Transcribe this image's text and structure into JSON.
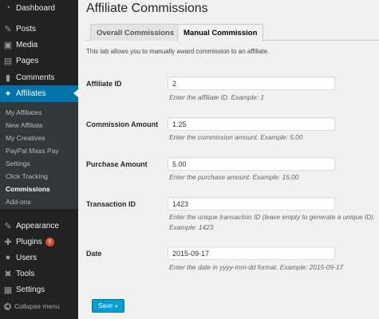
{
  "sidebar": {
    "menu": [
      {
        "id": "dashboard",
        "label": "Dashboard",
        "icon": "dashboard-icon",
        "glyph": "◔"
      },
      {
        "id": "posts",
        "label": "Posts",
        "icon": "pin-icon",
        "glyph": "✎"
      },
      {
        "id": "media",
        "label": "Media",
        "icon": "media-icon",
        "glyph": "▣"
      },
      {
        "id": "pages",
        "label": "Pages",
        "icon": "pages-icon",
        "glyph": "▤"
      },
      {
        "id": "comments",
        "label": "Comments",
        "icon": "comments-icon",
        "glyph": "▮"
      },
      {
        "id": "affiliates",
        "label": "Affiliates",
        "icon": "affiliates-icon",
        "glyph": "✦"
      }
    ],
    "submenu": [
      {
        "label": "My Affiliates"
      },
      {
        "label": "New Affiliate"
      },
      {
        "label": "My Creatives"
      },
      {
        "label": "PayPal Mass Pay"
      },
      {
        "label": "Settings"
      },
      {
        "label": "Click Tracking"
      },
      {
        "label": "Commissions"
      },
      {
        "label": "Add-ons"
      }
    ],
    "menu2": [
      {
        "id": "appearance",
        "label": "Appearance",
        "icon": "appearance-icon",
        "glyph": "✎"
      },
      {
        "id": "plugins",
        "label": "Plugins",
        "icon": "plugins-icon",
        "glyph": "✚",
        "badge": "9"
      },
      {
        "id": "users",
        "label": "Users",
        "icon": "users-icon",
        "glyph": "●"
      },
      {
        "id": "tools",
        "label": "Tools",
        "icon": "tools-icon",
        "glyph": "✖"
      },
      {
        "id": "settings",
        "label": "Settings",
        "icon": "settings-icon",
        "glyph": "▦"
      }
    ],
    "collapse_label": "Collapse menu"
  },
  "page": {
    "title": "Affiliate Commissions",
    "tabs": [
      {
        "label": "Overall Commissions"
      },
      {
        "label": "Manual Commission"
      }
    ],
    "description": "This tab allows you to manually award commission to an affiliate."
  },
  "form": {
    "affiliate_id": {
      "label": "Affiliate ID",
      "value": "2",
      "hint": "Enter the affiliate ID. Example: 1"
    },
    "commission_amount": {
      "label": "Commission Amount",
      "value": "1.25",
      "hint": "Enter the commission amount. Example: 5.00"
    },
    "purchase_amount": {
      "label": "Purchase Amount",
      "value": "5.00",
      "hint": "Enter the purchase amount. Example: 15.00"
    },
    "transaction_id": {
      "label": "Transaction ID",
      "value": "1423",
      "hint": "Enter the unique transaction ID (leave empty to generate a unique ID). Example: 1423"
    },
    "date": {
      "label": "Date",
      "value": "2015-09-17",
      "hint": "Enter the date in yyyy-mm-dd format. Example: 2015-09-17"
    }
  },
  "save_label": "Save »",
  "colors": {
    "sidebar": "#222222",
    "active": "#0073aa",
    "button": "#00a0d2",
    "badge": "#d54e21"
  }
}
